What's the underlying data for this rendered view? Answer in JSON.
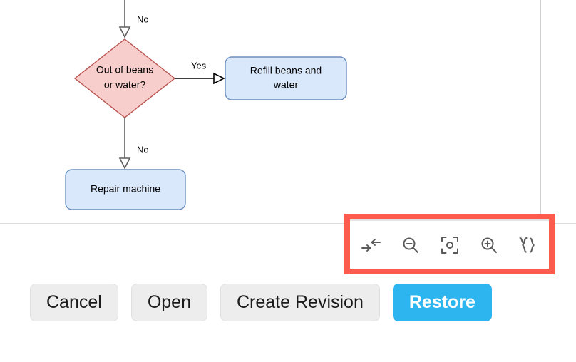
{
  "diagram": {
    "type": "flowchart",
    "nodes": [
      {
        "id": "decision-out-of-beans",
        "shape": "diamond",
        "line1": "Out of beans",
        "line2": "or water?",
        "fill": "#f8cecc",
        "stroke": "#b85450"
      },
      {
        "id": "process-refill",
        "shape": "rounded-rect",
        "line1": "Refill beans and",
        "line2": "water",
        "fill": "#dae8fc",
        "stroke": "#6c8ebf"
      },
      {
        "id": "process-repair",
        "shape": "rounded-rect",
        "line1": "Repair machine",
        "line2": "",
        "fill": "#dae8fc",
        "stroke": "#6c8ebf"
      }
    ],
    "edges": [
      {
        "id": "edge-top-into-decision",
        "label": "No"
      },
      {
        "id": "edge-decision-to-refill",
        "label": "Yes"
      },
      {
        "id": "edge-decision-to-repair",
        "label": "No"
      }
    ]
  },
  "zoom_toolbar": {
    "highlight_color": "#fc5b4e",
    "buttons": [
      {
        "id": "fit-to-page",
        "icon": "fit-arrows-icon",
        "label": "Fit page"
      },
      {
        "id": "zoom-out",
        "icon": "zoom-out-icon",
        "label": "Zoom out"
      },
      {
        "id": "reset-view",
        "icon": "reset-view-icon",
        "label": "Reset view"
      },
      {
        "id": "zoom-in",
        "icon": "zoom-in-icon",
        "label": "Zoom in"
      },
      {
        "id": "edit-source",
        "icon": "braces-icon",
        "label": "Edit source"
      }
    ]
  },
  "footer": {
    "buttons": [
      {
        "id": "cancel",
        "label": "Cancel",
        "style": "default"
      },
      {
        "id": "open",
        "label": "Open",
        "style": "default"
      },
      {
        "id": "create-revision",
        "label": "Create Revision",
        "style": "default"
      },
      {
        "id": "restore",
        "label": "Restore",
        "style": "primary"
      }
    ],
    "primary_color": "#2db5f0"
  }
}
